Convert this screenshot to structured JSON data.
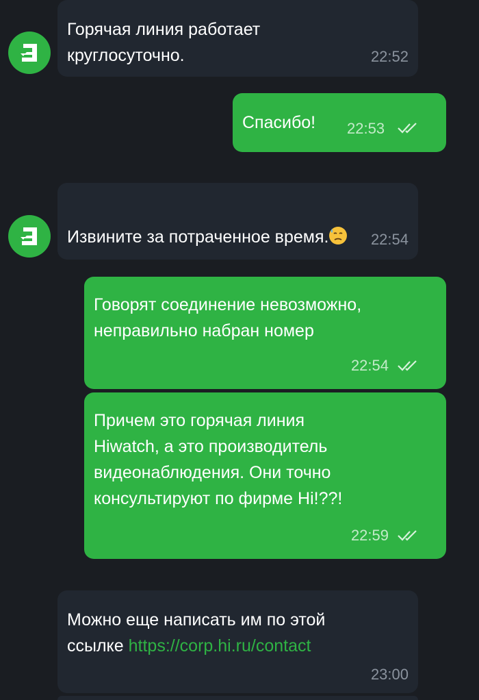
{
  "chat": {
    "messages": [
      {
        "direction": "incoming",
        "text": "Горячая линия работает\nкруглосуточно.",
        "time": "22:52"
      },
      {
        "direction": "outgoing",
        "text": "Спасибо!",
        "time": "22:53",
        "status": "read"
      },
      {
        "direction": "incoming",
        "text": "Извините за потраченное время.",
        "emoji": "downcast-face-with-sweat",
        "time": "22:54"
      },
      {
        "direction": "outgoing",
        "text": "Говорят соединение невозможно,\nнеправильно набран номер",
        "time": "22:54",
        "status": "read"
      },
      {
        "direction": "outgoing",
        "text": "Причем это горячая линия\nHiwatch, а это производитель\nвидеонаблюдения. Они точно\nконсультируют по фирме Hi!??!",
        "time": "22:59",
        "status": "read"
      },
      {
        "direction": "incoming",
        "text_prefix": "Можно еще написать им по этой\nссылке ",
        "link": "https://corp.hi.ru/contact",
        "time": "23:00"
      }
    ]
  },
  "avatar": {
    "icon": "lightning-logo-icon",
    "color": "#2fb344"
  },
  "colors": {
    "background": "#1a1d22",
    "incoming_bubble": "#212730",
    "outgoing_bubble": "#2fb344",
    "link": "#2fb344"
  }
}
